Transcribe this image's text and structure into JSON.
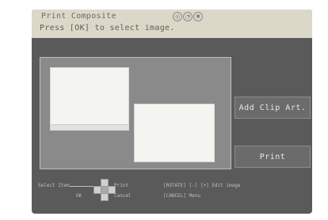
{
  "header": {
    "title": "Print Composite",
    "instruction": "Press [OK] to select image.",
    "icons": [
      "camera-icon",
      "clock-icon",
      "settings-icon"
    ]
  },
  "buttons": {
    "add_clip_art": "Add Clip Art.",
    "print": "Print"
  },
  "legend": {
    "select_item": "Select Item",
    "print": "Print",
    "ok": "OK",
    "cancel": "Cancel",
    "rotate_edit": "[ROTATE] [-] [+] Edit image",
    "menu": "[CANCEL] Menu"
  },
  "colors": {
    "panel_bg": "#5a5a5a",
    "header_bg": "#dcd8c8",
    "button_bg": "#6b6b6b"
  }
}
